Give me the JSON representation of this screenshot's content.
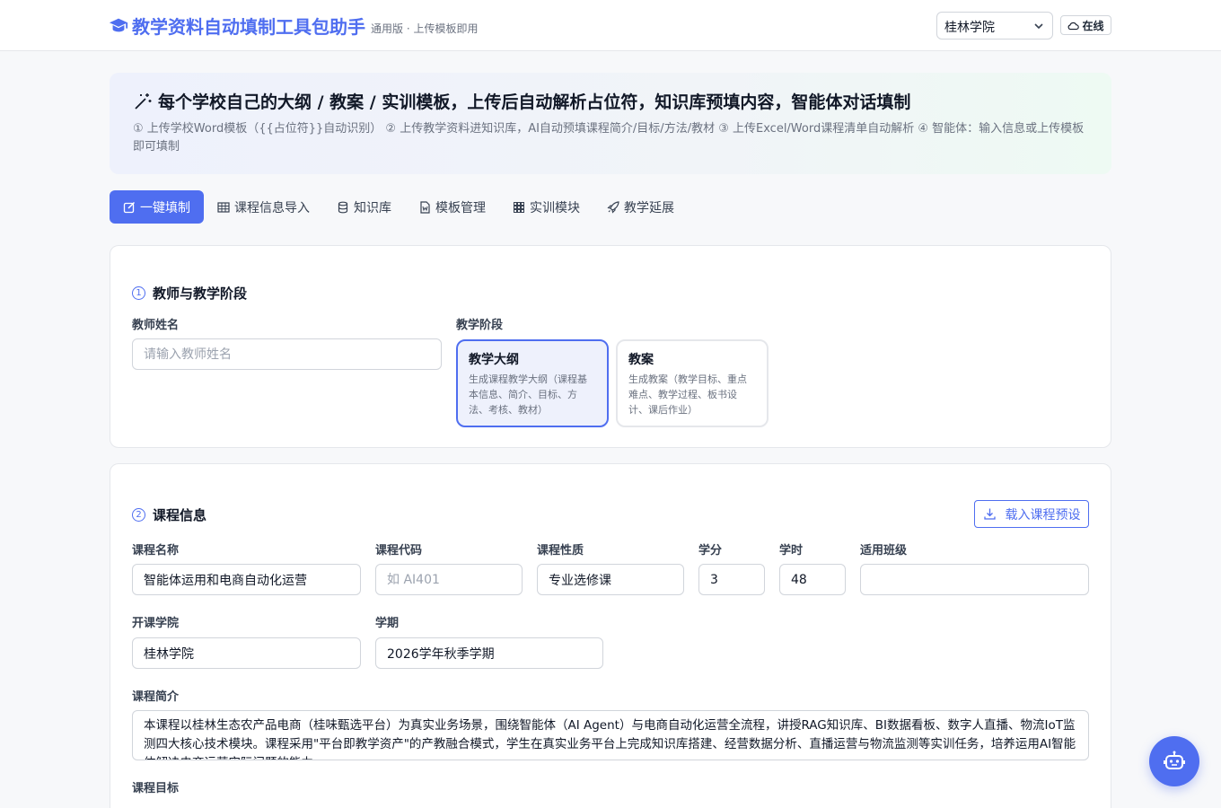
{
  "header": {
    "title": "教学资料自动填制工具包助手",
    "subtitle": "通用版 · 上传模板即用",
    "school_select": "桂林学院",
    "status": "在线"
  },
  "hero": {
    "title": "每个学校自己的大纲 / 教案 / 实训模板，上传后自动解析占位符，知识库预填内容，智能体对话填制",
    "desc": "① 上传学校Word模板（{{占位符}}自动识别） ② 上传教学资料进知识库，AI自动预填课程简介/目标/方法/教材 ③ 上传Excel/Word课程清单自动解析 ④ 智能体：输入信息或上传模板即可填制"
  },
  "tabs": [
    {
      "label": "一键填制",
      "icon": "edit-icon"
    },
    {
      "label": "课程信息导入",
      "icon": "table-icon"
    },
    {
      "label": "知识库",
      "icon": "database-icon"
    },
    {
      "label": "模板管理",
      "icon": "word-file-icon"
    },
    {
      "label": "实训模块",
      "icon": "grid-icon"
    },
    {
      "label": "教学延展",
      "icon": "rocket-icon"
    }
  ],
  "section1": {
    "num": "1",
    "title": "教师与教学阶段",
    "teacher_label": "教师姓名",
    "teacher_placeholder": "请输入教师姓名",
    "stage_label": "教学阶段",
    "stages": [
      {
        "title": "教学大纲",
        "desc": "生成课程教学大纲（课程基本信息、简介、目标、方法、考核、教材）",
        "selected": true
      },
      {
        "title": "教案",
        "desc": "生成教案（教学目标、重点难点、教学过程、板书设计、课后作业）",
        "selected": false
      }
    ]
  },
  "section2": {
    "num": "2",
    "title": "课程信息",
    "preset_button": "载入课程预设",
    "fields": {
      "name": {
        "label": "课程名称",
        "value": "智能体运用和电商自动化运营"
      },
      "code": {
        "label": "课程代码",
        "placeholder": "如 AI401"
      },
      "nature": {
        "label": "课程性质",
        "value": "专业选修课"
      },
      "credit": {
        "label": "学分",
        "value": "3"
      },
      "hours": {
        "label": "学时",
        "value": "48"
      },
      "classes": {
        "label": "适用班级",
        "value": ""
      },
      "college": {
        "label": "开课学院",
        "value": "桂林学院"
      },
      "term": {
        "label": "学期",
        "value": "2026学年秋季学期"
      }
    },
    "intro_label": "课程简介",
    "intro_text": "本课程以桂林生态农产品电商（桂味甄选平台）为真实业务场景，围绕智能体（AI Agent）与电商自动化运营全流程，讲授RAG知识库、BI数据看板、数字人直播、物流IoT监测四大核心技术模块。课程采用\"平台即教学资产\"的产教融合模式，学生在真实业务平台上完成知识库搭建、经营数据分析、直播运营与物流监测等实训任务，培养运用AI智能体解决电商运营实际问题的能力。",
    "goal_label": "课程目标"
  }
}
